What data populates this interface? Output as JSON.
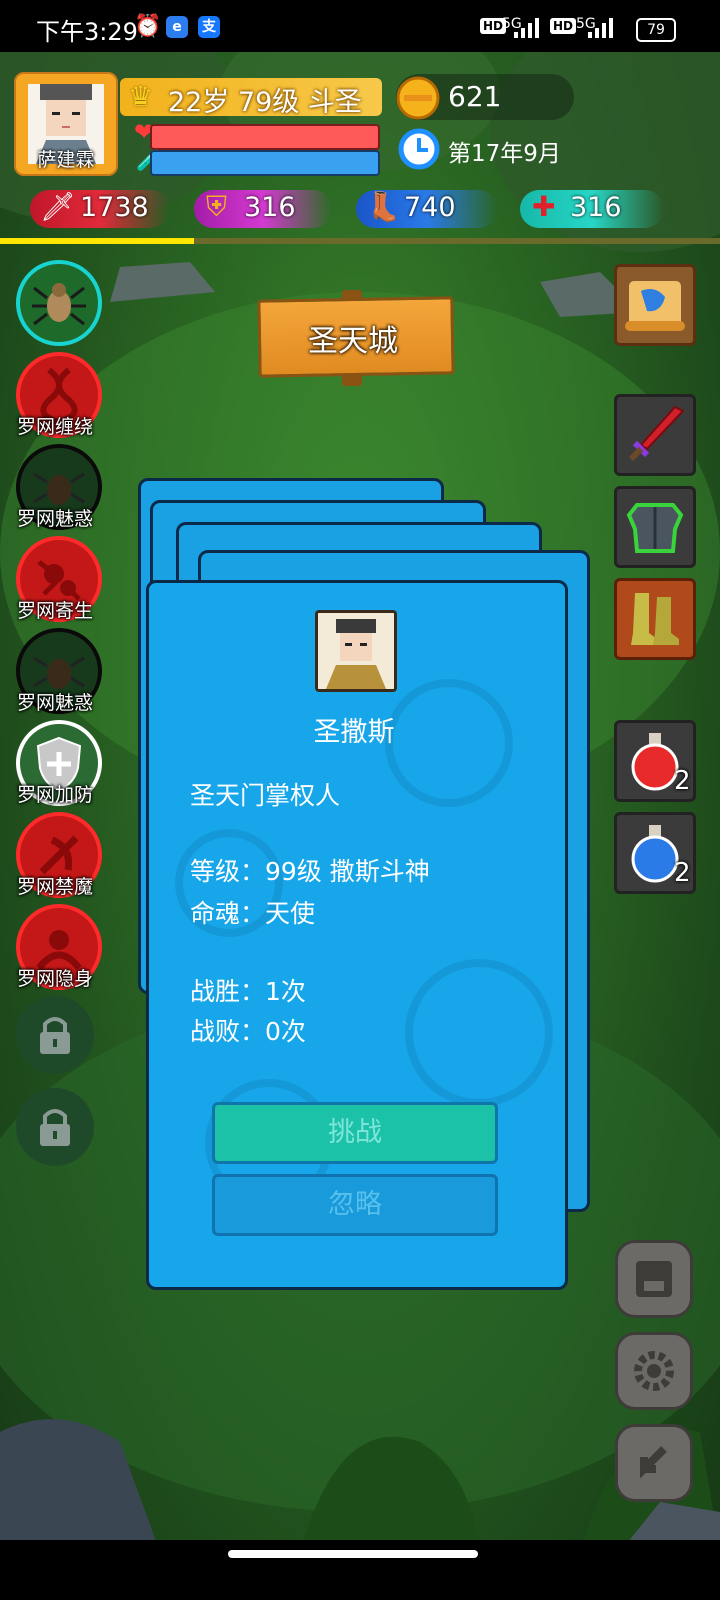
{
  "status_bar": {
    "time": "下午3:29",
    "network_1": "5G",
    "network_2": "5G",
    "battery": "79"
  },
  "player": {
    "name": "萨建霖",
    "rank": "22岁 79级 斗圣",
    "gold": "621",
    "date": "第17年9月",
    "stats": {
      "attack": "1738",
      "defense": "316",
      "speed": "740",
      "health": "316"
    },
    "hp_fraction": 1.0,
    "mp_fraction": 1.0,
    "progress_fraction": 0.27
  },
  "location": "圣天城",
  "skills": [
    {
      "label": "",
      "icon": "spider-icon"
    },
    {
      "label": "罗网缠绕",
      "icon": "entangle-icon"
    },
    {
      "label": "罗网魅惑",
      "icon": "charm-icon"
    },
    {
      "label": "罗网寄生",
      "icon": "parasite-icon"
    },
    {
      "label": "罗网魅惑",
      "icon": "charm-icon"
    },
    {
      "label": "罗网加防",
      "icon": "shield-icon"
    },
    {
      "label": "罗网禁魔",
      "icon": "silence-icon"
    },
    {
      "label": "罗网隐身",
      "icon": "stealth-icon"
    }
  ],
  "items": {
    "map": "map-scroll-icon",
    "weapon": "sword-icon",
    "armor": "armor-icon",
    "boots": "boots-icon",
    "red_potion_count": "2",
    "blue_potion_count": "2"
  },
  "card": {
    "name": "圣撒斯",
    "title": "圣天门掌权人",
    "level": "等级：99级 撒斯斗神",
    "soul": "命魂：天使",
    "wins": "战胜：1次",
    "losses": "战败：0次",
    "challenge_label": "挑战",
    "ignore_label": "忽略"
  }
}
